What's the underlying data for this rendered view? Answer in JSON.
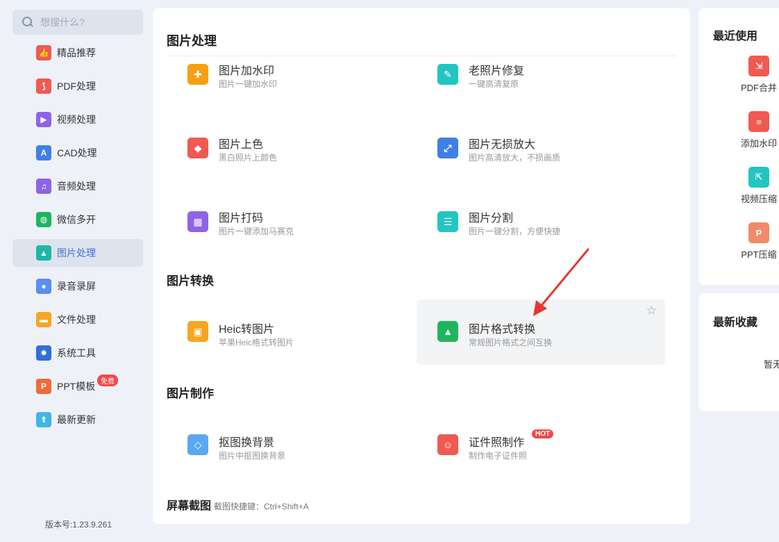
{
  "search": {
    "placeholder": "想搜什么?"
  },
  "sidebar": {
    "items": [
      {
        "label": "精品推荐",
        "icon": "thumbs-up-icon",
        "color": "#f05a52",
        "glyph": "👍"
      },
      {
        "label": "PDF处理",
        "icon": "pdf-icon",
        "color": "#f05a52",
        "glyph": "⟆"
      },
      {
        "label": "视频处理",
        "icon": "video-play-icon",
        "color": "#8f63e8",
        "glyph": "▶"
      },
      {
        "label": "CAD处理",
        "icon": "cad-icon",
        "color": "#3f7fe8",
        "glyph": "A"
      },
      {
        "label": "音频处理",
        "icon": "music-note-icon",
        "color": "#8f63e8",
        "glyph": "♫"
      },
      {
        "label": "微信多开",
        "icon": "wechat-icon",
        "color": "#1fb55f",
        "glyph": "◍"
      },
      {
        "label": "图片处理",
        "icon": "image-icon",
        "color": "#1fb6a8",
        "glyph": "▲"
      },
      {
        "label": "录音录屏",
        "icon": "microphone-icon",
        "color": "#5b8ef0",
        "glyph": "●"
      },
      {
        "label": "文件处理",
        "icon": "folder-icon",
        "color": "#f5a623",
        "glyph": "▬"
      },
      {
        "label": "系统工具",
        "icon": "gear-icon",
        "color": "#2f6fd8",
        "glyph": "✹"
      },
      {
        "label": "PPT模板",
        "icon": "ppt-icon",
        "color": "#f06a3a",
        "glyph": "P"
      },
      {
        "label": "最新更新",
        "icon": "upload-icon",
        "color": "#3fb5e8",
        "glyph": "⬆"
      }
    ],
    "active_index": 6,
    "badge_free": "免费",
    "version": "版本号:1.23.9.261"
  },
  "main": {
    "sections": {
      "image_processing": "图片处理",
      "image_conversion": "图片转换",
      "image_making": "图片制作",
      "screenshot": "屏幕截图",
      "screenshot_hint": "截图快捷键：Ctrl+Shift+A"
    },
    "tools": [
      {
        "name": "图片加水印",
        "desc": "图片一键加水印",
        "icon": "watermark-icon",
        "color": "#f5a012",
        "glyph": "✚"
      },
      {
        "name": "老照片修复",
        "desc": "一键高清复原",
        "icon": "wrench-icon",
        "color": "#22c5c0",
        "glyph": "✎"
      },
      {
        "name": "图片上色",
        "desc": "黑白照片上颜色",
        "icon": "paint-bucket-icon",
        "color": "#f05a52",
        "glyph": "◆"
      },
      {
        "name": "图片无损放大",
        "desc": "图片高清放大，不损画质",
        "icon": "enlarge-icon",
        "color": "#3f7fe8",
        "glyph": "⤢"
      },
      {
        "name": "图片打码",
        "desc": "图片一键添加马赛克",
        "icon": "mosaic-icon",
        "color": "#8f63e8",
        "glyph": "▦"
      },
      {
        "name": "图片分割",
        "desc": "图片一键分割，方便快捷",
        "icon": "split-icon",
        "color": "#22c5c0",
        "glyph": "☰"
      },
      {
        "name": "Heic转图片",
        "desc": "苹果Heic格式转图片",
        "icon": "heic-convert-icon",
        "color": "#f5a623",
        "glyph": "▣"
      },
      {
        "name": "图片格式转换",
        "desc": "常规图片格式之间互换",
        "icon": "format-convert-icon",
        "color": "#1fb55f",
        "glyph": "▲"
      },
      {
        "name": "抠图换背景",
        "desc": "图片中抠图换背景",
        "icon": "cutout-icon",
        "color": "#5aa8f0",
        "glyph": "◇"
      },
      {
        "name": "证件照制作",
        "desc": "制作电子证件照",
        "icon": "id-photo-icon",
        "color": "#f05a52",
        "glyph": "☺"
      }
    ],
    "hot_badge": "HOT",
    "highlighted_tool_index": 7
  },
  "recent": {
    "title": "最近使用",
    "items": [
      {
        "label": "PDF合并",
        "icon": "pdf-merge-icon",
        "color": "#f05a52",
        "glyph": "⇲"
      },
      {
        "label": "添加水印",
        "icon": "add-watermark-icon",
        "color": "#f05a52",
        "glyph": "≡"
      },
      {
        "label": "视频压缩",
        "icon": "video-compress-icon",
        "color": "#22c5c0",
        "glyph": "⇱"
      },
      {
        "label": "PPT压缩",
        "icon": "ppt-compress-icon",
        "color": "#f08a6a",
        "glyph": "P"
      }
    ]
  },
  "favorites": {
    "title": "最新收藏",
    "empty_text": "暂无收藏"
  },
  "annotation": {
    "arrow_color": "#e8362e"
  }
}
